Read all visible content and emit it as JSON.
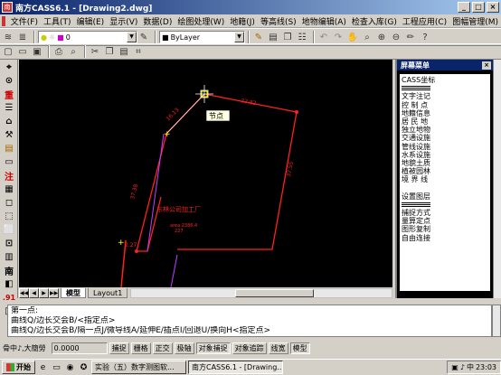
{
  "window": {
    "title": "南方CASS6.1 - [Drawing2.dwg]"
  },
  "menu": [
    "文件(F)",
    "工具(T)",
    "编辑(E)",
    "显示(V)",
    "数据(D)",
    "绘图处理(W)",
    "地籍(J)",
    "等高线(S)",
    "地物编辑(A)",
    "检查入库(G)",
    "工程应用(C)",
    "图幅管理(M)"
  ],
  "toolbar": {
    "layer_combo": "0",
    "linetype_combo": "ByLayer"
  },
  "left_tools": [
    "⌖",
    "⊙",
    "重",
    "☰",
    "⌂",
    "⚒",
    "▤",
    "▭",
    "注",
    "▦",
    "◻",
    "⬚",
    "⬜",
    "⊡",
    "▥",
    "南",
    "◧",
    ".91",
    "◨",
    "/"
  ],
  "canvas": {
    "tooltip": "节点",
    "labels": {
      "edge_top": "22.82",
      "edge_diag": "16.13",
      "edge_left": "37.38",
      "edge_right": "37.55",
      "name": "东林公司加工厂",
      "area": "area 2386.4",
      "id": "227",
      "corner": "2.27"
    }
  },
  "tabs": {
    "model": "模型",
    "layout": "Layout1"
  },
  "screen_menu": {
    "title": "屏幕菜单",
    "items": [
      "CASS坐标",
      "SEP",
      "文字注记",
      "控 制 点",
      "地籍信息",
      "居 民 地",
      "独立地物",
      "交通设施",
      "管线设施",
      "水系设施",
      "地貌土质",
      "植被园林",
      "境 界 线",
      "BLANK",
      "设置图层",
      "SEP",
      "捕捉方式",
      "量算定点",
      "图形复制",
      "自由连接"
    ]
  },
  "command": {
    "lines": [
      "第一点:",
      "曲线Q/边长交会B/<指定点>",
      "曲线Q/边长交会B/隔一点J/微导线A/延伸E/插点I/回退U/换向H<指定点>"
    ]
  },
  "status": {
    "snap_label": "骨中♪,大簡勞",
    "coords": "0.0000",
    "buttons": [
      {
        "label": "捕捉",
        "on": false
      },
      {
        "label": "栅格",
        "on": false
      },
      {
        "label": "正交",
        "on": false
      },
      {
        "label": "极轴",
        "on": false
      },
      {
        "label": "对象捕捉",
        "on": true
      },
      {
        "label": "对象追踪",
        "on": false
      },
      {
        "label": "线宽",
        "on": false
      },
      {
        "label": "模型",
        "on": true
      }
    ]
  },
  "taskbar": {
    "start": "开始",
    "tasks": [
      {
        "label": "实验（五）数字测图软...",
        "active": false
      },
      {
        "label": "南方CASS6.1 - [Drawing...",
        "active": true
      }
    ],
    "clock": "23:03"
  },
  "colors": {
    "line_red": "#ff2020",
    "line_magenta": "#c040ff",
    "text_red": "#ff2020",
    "node_yellow": "#ffff00"
  }
}
